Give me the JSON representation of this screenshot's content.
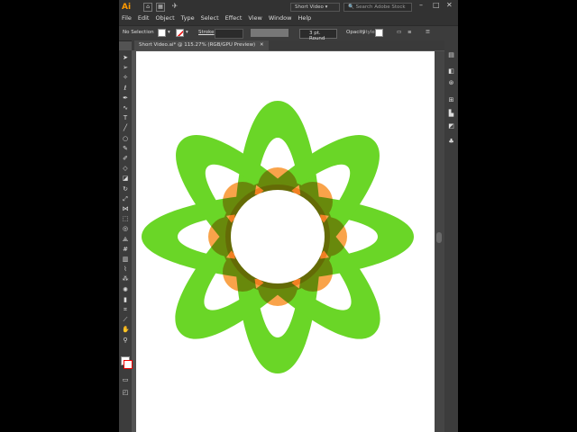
{
  "app": {
    "logo": "Ai",
    "workspace": "Short Video",
    "search_placeholder": "Search Adobe Stock"
  },
  "menu": [
    "File",
    "Edit",
    "Object",
    "Type",
    "Select",
    "Effect",
    "View",
    "Window",
    "Help"
  ],
  "control_bar": {
    "selection": "No Selection",
    "stroke_label": "Stroke",
    "brush": "3 pt. Round",
    "opacity_label": "Opacity",
    "style_label": "Style"
  },
  "document_tab": "Short Video.ai* @ 115.27% (RGB/GPU Preview)",
  "colors": {
    "petal_green": "#6ad627",
    "petal_orange": "#f9a34a",
    "ui_dark": "#323232",
    "ui_panel": "#3c3c3c"
  },
  "icons": [
    "selection-tool-icon",
    "direct-select-icon",
    "magic-wand-icon",
    "lasso-icon",
    "pen-icon",
    "curvature-icon",
    "type-icon",
    "line-icon",
    "ellipse-icon",
    "paintbrush-icon",
    "pencil-icon",
    "shaper-icon",
    "eraser-icon",
    "rotate-icon",
    "scale-icon",
    "width-icon",
    "free-transform-icon",
    "shape-builder-icon",
    "perspective-icon",
    "mesh-icon",
    "gradient-icon",
    "eyedropper-icon",
    "blend-icon",
    "symbol-sprayer-icon",
    "graph-icon",
    "artboard-tool-icon",
    "slice-icon",
    "hand-icon",
    "zoom-icon"
  ]
}
